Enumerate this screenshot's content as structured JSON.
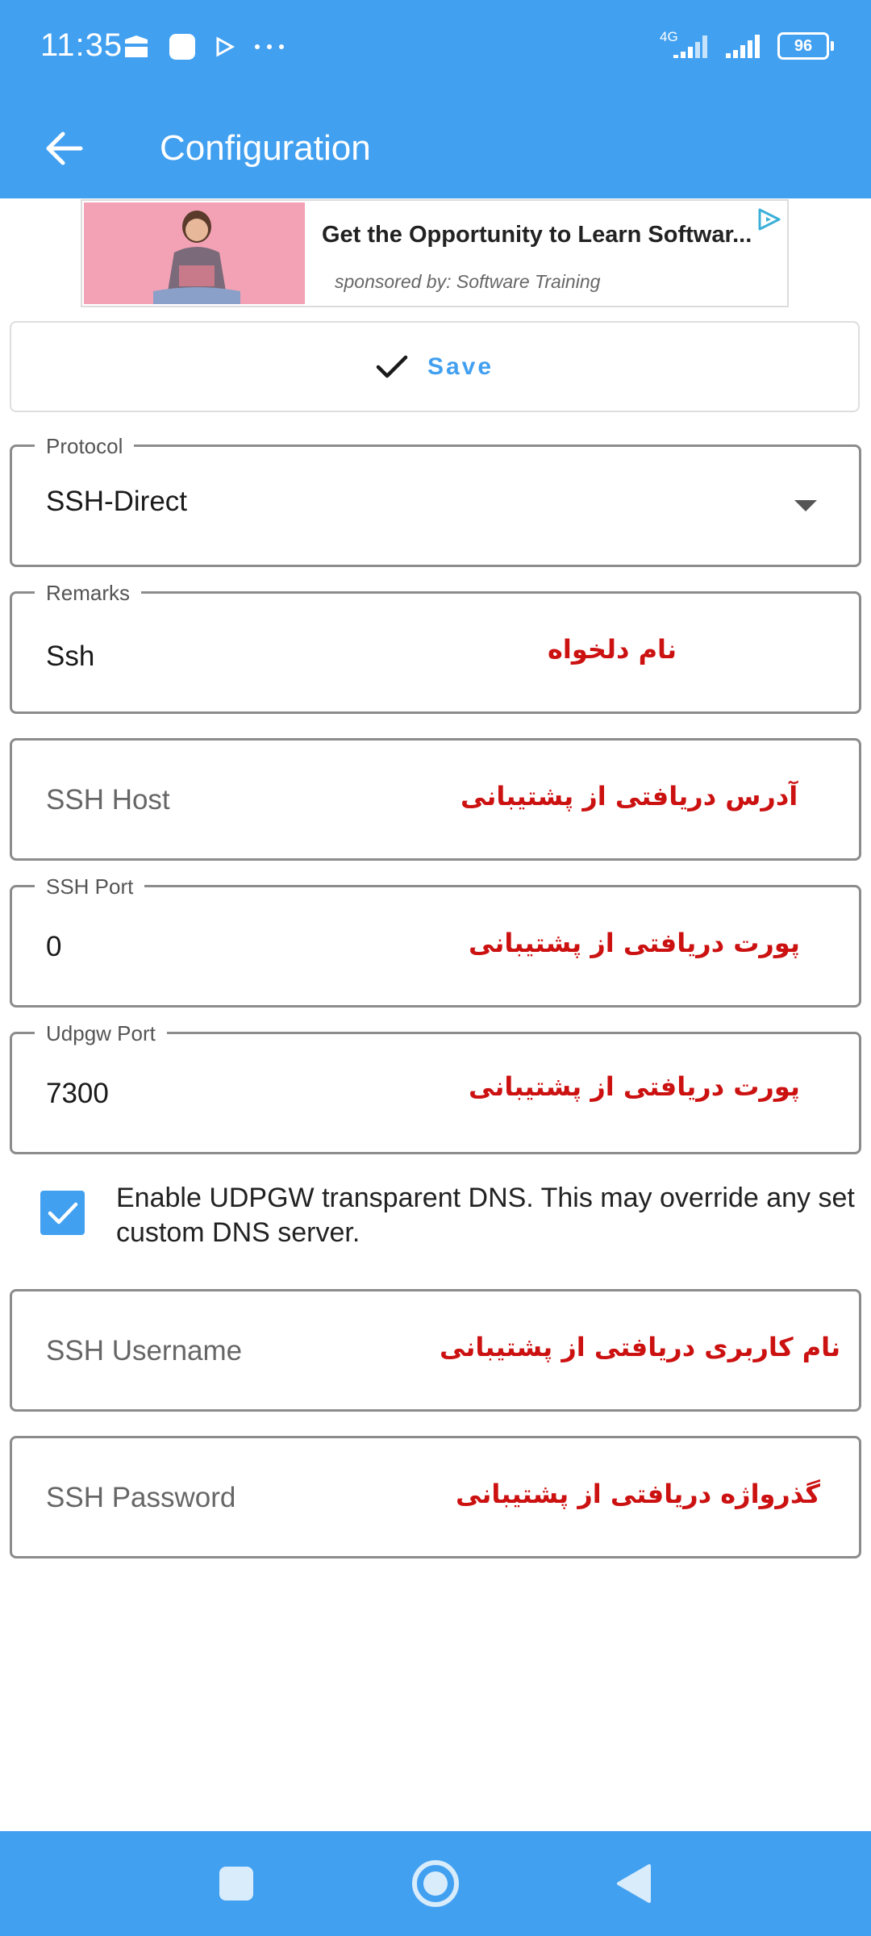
{
  "status_bar": {
    "time": "11:35",
    "network": "4G",
    "battery": "96"
  },
  "app_bar": {
    "title": "Configuration"
  },
  "ad": {
    "title": "Get the Opportunity to Learn Softwar...",
    "sponsor": "sponsored by: Software Training"
  },
  "save_button": {
    "label": "Save"
  },
  "fields": {
    "protocol": {
      "label": "Protocol",
      "value": "SSH-Direct"
    },
    "remarks": {
      "label": "Remarks",
      "value": "Ssh",
      "annotation": "نام دلخواه"
    },
    "ssh_host": {
      "placeholder": "SSH Host",
      "annotation": "آدرس دریافتی از پشتیبانی"
    },
    "ssh_port": {
      "label": "SSH Port",
      "value": "0",
      "annotation": "پورت دریافتی از پشتیبانی"
    },
    "udpgw_port": {
      "label": "Udpgw Port",
      "value": "7300",
      "annotation": "پورت دریافتی از پشتیبانی"
    },
    "ssh_username": {
      "placeholder": "SSH Username",
      "annotation": "نام کاربری دریافتی از پشتیبانی"
    },
    "ssh_password": {
      "placeholder": "SSH Password",
      "annotation": "گذرواژه دریافتی از پشتیبانی"
    }
  },
  "udpgw_dns": {
    "checked": true,
    "label": "Enable UDPGW transparent DNS. This may override any set custom DNS server."
  },
  "colors": {
    "primary": "#42a0f0",
    "annotation": "#cc1111"
  }
}
